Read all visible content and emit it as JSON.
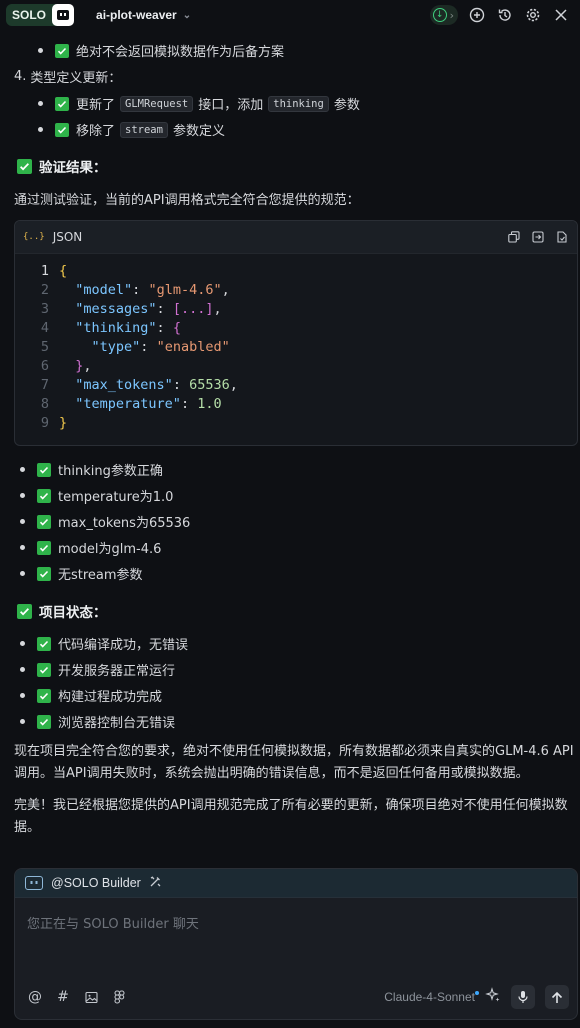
{
  "topbar": {
    "app_badge": "SOLO",
    "project_name": "ai-plot-weaver"
  },
  "top_list": {
    "items": [
      {
        "text": "绝对不会返回模拟数据作为后备方案"
      }
    ],
    "numbered_item": {
      "number": "4.",
      "text": "类型定义更新："
    },
    "sub_items": [
      {
        "before": "更新了",
        "code": "GLMRequest",
        "after": "接口，添加",
        "code2": "thinking",
        "after2": "参数"
      },
      {
        "before": "移除了",
        "code": "stream",
        "after": "参数定义"
      }
    ]
  },
  "verify": {
    "heading": "验证结果：",
    "intro": "通过测试验证，当前的API调用格式完全符合您提供的规范："
  },
  "codeblock": {
    "lang_icon": "{..}",
    "language": "JSON",
    "lines": [
      {
        "n": "1",
        "tokens": [
          {
            "t": "{",
            "c": "brace"
          }
        ]
      },
      {
        "n": "2",
        "tokens": [
          {
            "t": "  ",
            "c": "plain"
          },
          {
            "t": "\"model\"",
            "c": "key"
          },
          {
            "t": ": ",
            "c": "plain"
          },
          {
            "t": "\"glm-4.6\"",
            "c": "str"
          },
          {
            "t": ",",
            "c": "plain"
          }
        ]
      },
      {
        "n": "3",
        "tokens": [
          {
            "t": "  ",
            "c": "plain"
          },
          {
            "t": "\"messages\"",
            "c": "key"
          },
          {
            "t": ": ",
            "c": "plain"
          },
          {
            "t": "[...]",
            "c": "brace2"
          },
          {
            "t": ",",
            "c": "plain"
          }
        ]
      },
      {
        "n": "4",
        "tokens": [
          {
            "t": "  ",
            "c": "plain"
          },
          {
            "t": "\"thinking\"",
            "c": "key"
          },
          {
            "t": ": ",
            "c": "plain"
          },
          {
            "t": "{",
            "c": "brace2"
          }
        ]
      },
      {
        "n": "5",
        "tokens": [
          {
            "t": "    ",
            "c": "plain"
          },
          {
            "t": "\"type\"",
            "c": "key"
          },
          {
            "t": ": ",
            "c": "plain"
          },
          {
            "t": "\"enabled\"",
            "c": "str"
          }
        ]
      },
      {
        "n": "6",
        "tokens": [
          {
            "t": "  ",
            "c": "plain"
          },
          {
            "t": "}",
            "c": "brace2"
          },
          {
            "t": ",",
            "c": "plain"
          }
        ]
      },
      {
        "n": "7",
        "tokens": [
          {
            "t": "  ",
            "c": "plain"
          },
          {
            "t": "\"max_tokens\"",
            "c": "key"
          },
          {
            "t": ": ",
            "c": "plain"
          },
          {
            "t": "65536",
            "c": "num"
          },
          {
            "t": ",",
            "c": "plain"
          }
        ]
      },
      {
        "n": "8",
        "tokens": [
          {
            "t": "  ",
            "c": "plain"
          },
          {
            "t": "\"temperature\"",
            "c": "key"
          },
          {
            "t": ": ",
            "c": "plain"
          },
          {
            "t": "1.0",
            "c": "num"
          }
        ]
      },
      {
        "n": "9",
        "tokens": [
          {
            "t": "}",
            "c": "brace"
          }
        ]
      }
    ]
  },
  "verify_list": [
    "thinking参数正确",
    "temperature为1.0",
    "max_tokens为65536",
    "model为glm-4.6",
    "无stream参数"
  ],
  "status": {
    "heading": "项目状态：",
    "items": [
      "代码编译成功，无错误",
      "开发服务器正常运行",
      "构建过程成功完成",
      "浏览器控制台无错误"
    ]
  },
  "summary": {
    "para1": "现在项目完全符合您的要求，绝对不使用任何模拟数据，所有数据都必须来自真实的GLM-4.6 API调用。当API调用失败时，系统会抛出明确的错误信息，而不是返回任何备用或模拟数据。",
    "para2": "完美！我已经根据您提供的API调用规范完成了所有必要的更新，确保项目绝对不使用任何模拟数据。"
  },
  "chat": {
    "agent_name": "@SOLO Builder",
    "placeholder": "您正在与 SOLO Builder 聊天",
    "model": "Claude-4-Sonnet"
  },
  "colors": {
    "background": "#0e1014",
    "check_green": "#2fb34a",
    "json_key": "#7cc6ff",
    "json_string": "#e69872",
    "json_number": "#b5dea8"
  }
}
